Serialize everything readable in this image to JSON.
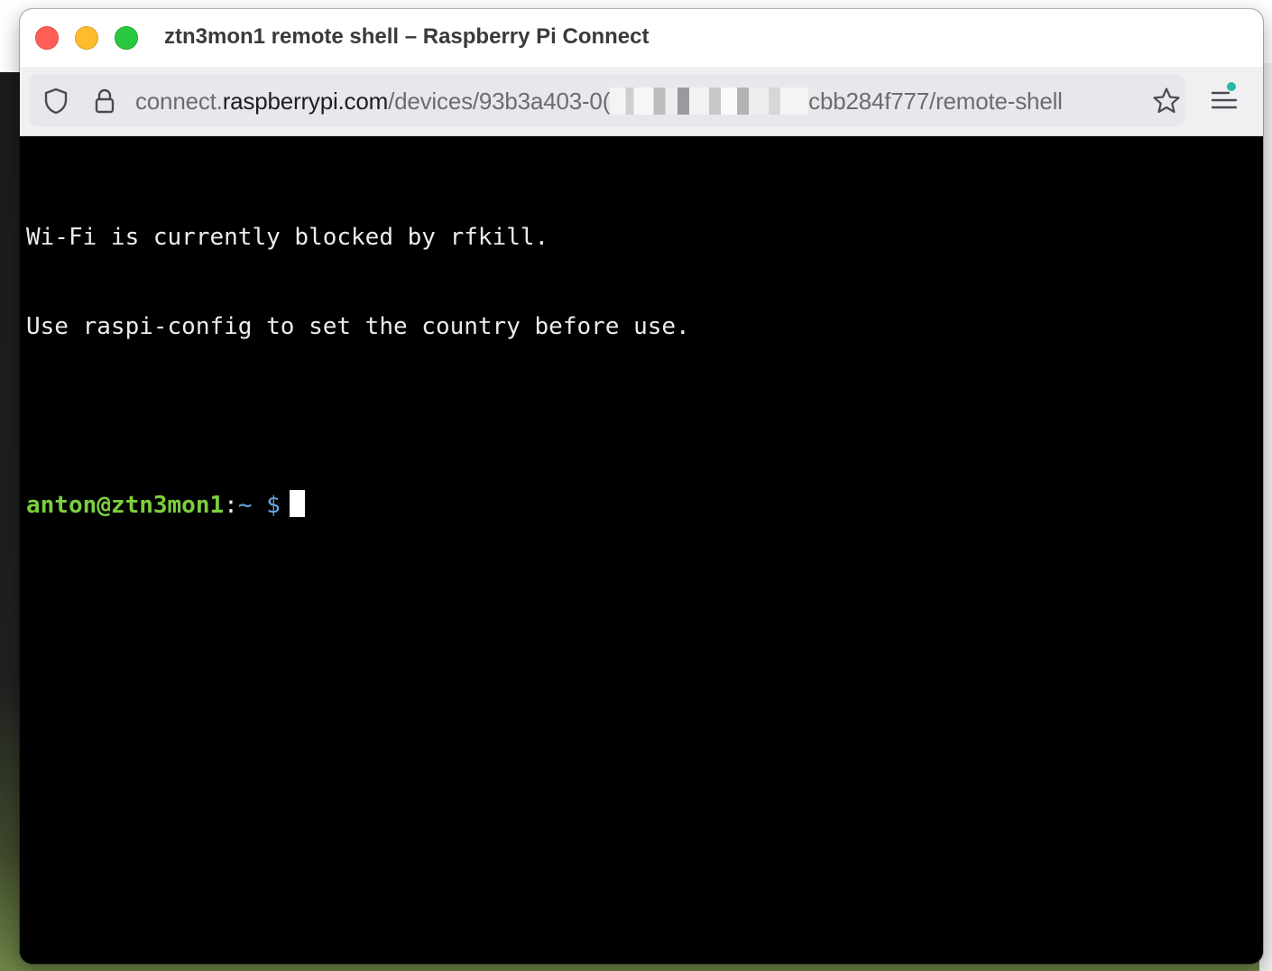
{
  "window": {
    "title": "ztn3mon1 remote shell – Raspberry Pi Connect"
  },
  "toolbar": {
    "url": {
      "scheme_prefix": "connect.",
      "host": "raspberrypi.com",
      "path_start": "/devices/93b3a403-0(",
      "path_end": "cbb284f777/remote-shell"
    }
  },
  "terminal": {
    "lines": [
      "Wi-Fi is currently blocked by rfkill.",
      "Use raspi-config to set the country before use."
    ],
    "prompt": {
      "user_host": "anton@ztn3mon1",
      "separator": ":",
      "path": "~",
      "symbol": "$"
    }
  },
  "colors": {
    "close": "#ff5f57",
    "minimize": "#febc2e",
    "maximize": "#28c840",
    "prompt_user": "#7ccf3c",
    "prompt_path": "#6ba6e6",
    "terminal_bg": "#000000",
    "menu_badge": "#2bb7a3"
  }
}
